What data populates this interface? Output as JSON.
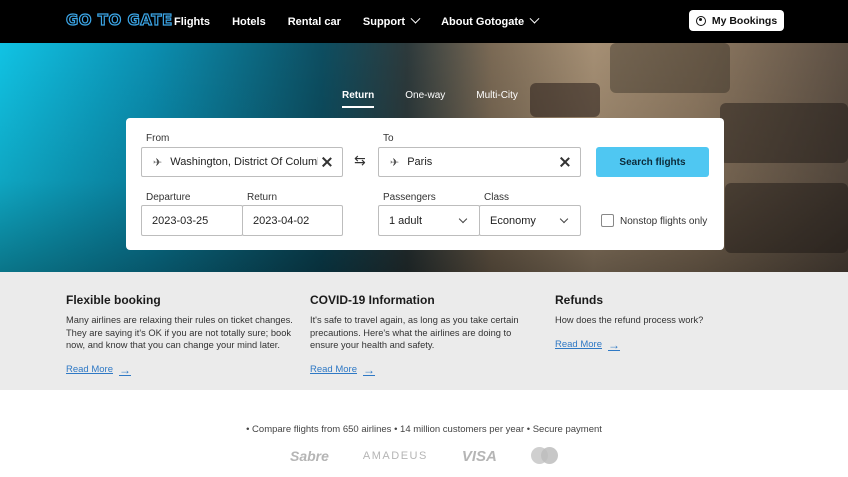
{
  "header": {
    "logo": "GO TO GATE",
    "nav": [
      {
        "label": "Flights",
        "dropdown": false
      },
      {
        "label": "Hotels",
        "dropdown": false
      },
      {
        "label": "Rental car",
        "dropdown": false
      },
      {
        "label": "Support",
        "dropdown": true
      },
      {
        "label": "About Gotogate",
        "dropdown": true
      }
    ],
    "my_bookings": "My Bookings"
  },
  "search": {
    "trip_tabs": [
      "Return",
      "One-way",
      "Multi-City"
    ],
    "active_tab": "Return",
    "from_label": "From",
    "from_value": "Washington, District Of Columbia",
    "to_label": "To",
    "to_value": "Paris",
    "search_button": "Search flights",
    "departure_label": "Departure",
    "departure_value": "2023-03-25",
    "return_label": "Return",
    "return_value": "2023-04-02",
    "passengers_label": "Passengers",
    "passengers_value": "1 adult",
    "class_label": "Class",
    "class_value": "Economy",
    "nonstop_label": "Nonstop flights only",
    "nonstop_checked": false
  },
  "info": [
    {
      "title": "Flexible booking",
      "text": "Many airlines are relaxing their rules on ticket changes. They are saying it's OK if you are not totally sure; book now, and know that you can change your mind later.",
      "link": "Read More"
    },
    {
      "title": "COVID-19 Information",
      "text": "It's safe to travel again, as long as you take certain precautions. Here's what the airlines are doing to ensure your health and safety.",
      "link": "Read More"
    },
    {
      "title": "Refunds",
      "text": "How does the refund process work?",
      "link": "Read More"
    }
  ],
  "footer": {
    "usp": "• Compare flights from 650 airlines  • 14 million customers per year  • Secure payment",
    "partners": [
      "Sabre",
      "AMADEUS",
      "VISA",
      "mastercard"
    ]
  },
  "colors": {
    "header_bg": "#000000",
    "logo_accent": "#3ba5e6",
    "search_button": "#4fc7f2",
    "link": "#2f79c5",
    "info_bg": "#ebebeb"
  }
}
